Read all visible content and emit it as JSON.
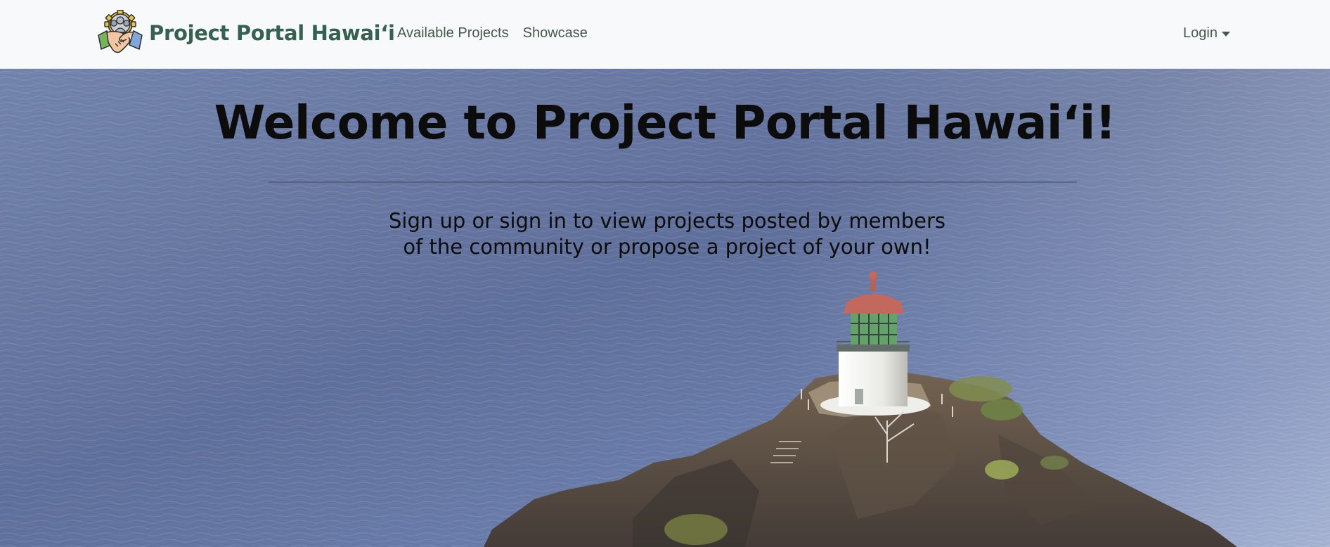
{
  "navbar": {
    "brand": {
      "title": "Project Portal Hawai‘i",
      "logo_icon": "handshake-gear-people-icon"
    },
    "links": [
      {
        "label": "Available Projects"
      },
      {
        "label": "Showcase"
      }
    ],
    "login": {
      "label": "Login",
      "caret_icon": "caret-down-icon"
    }
  },
  "hero": {
    "title": "Welcome to Project Portal Hawai‘i!",
    "subtitle": "Sign up or sign in to view projects posted by members of the community or propose a project of your own!",
    "background_image": "ocean-lighthouse-photo"
  },
  "colors": {
    "brand": "#356250",
    "nav_text": "#45584c",
    "navbar_bg": "#f8f9fa",
    "hero_text": "#0c0c0c",
    "ocean": "#5e6f9c"
  }
}
